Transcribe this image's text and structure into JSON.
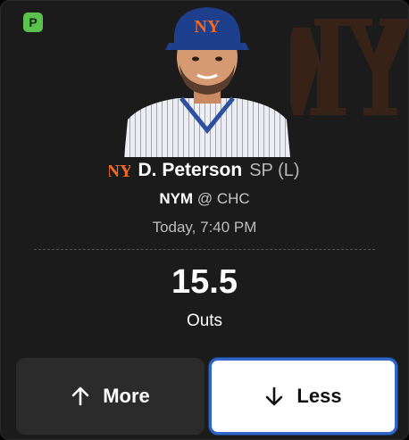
{
  "badge": {
    "letter": "P",
    "color": "#5ac24d"
  },
  "player": {
    "name": "D. Peterson",
    "position": "SP (L)",
    "team_icon": "mets-logo-icon"
  },
  "matchup": {
    "team": "NYM",
    "separator": "@",
    "opponent": "CHC"
  },
  "game_time": "Today, 7:40 PM",
  "projection": {
    "value": "15.5",
    "stat": "Outs"
  },
  "buttons": {
    "more_label": "More",
    "more_icon": "arrow-up-icon",
    "less_label": "Less",
    "less_icon": "arrow-down-icon",
    "selected": "less"
  },
  "colors": {
    "accent_blue": "#2f66c8",
    "mets_orange": "#f26a21",
    "card_bg": "#1b1b1b"
  }
}
